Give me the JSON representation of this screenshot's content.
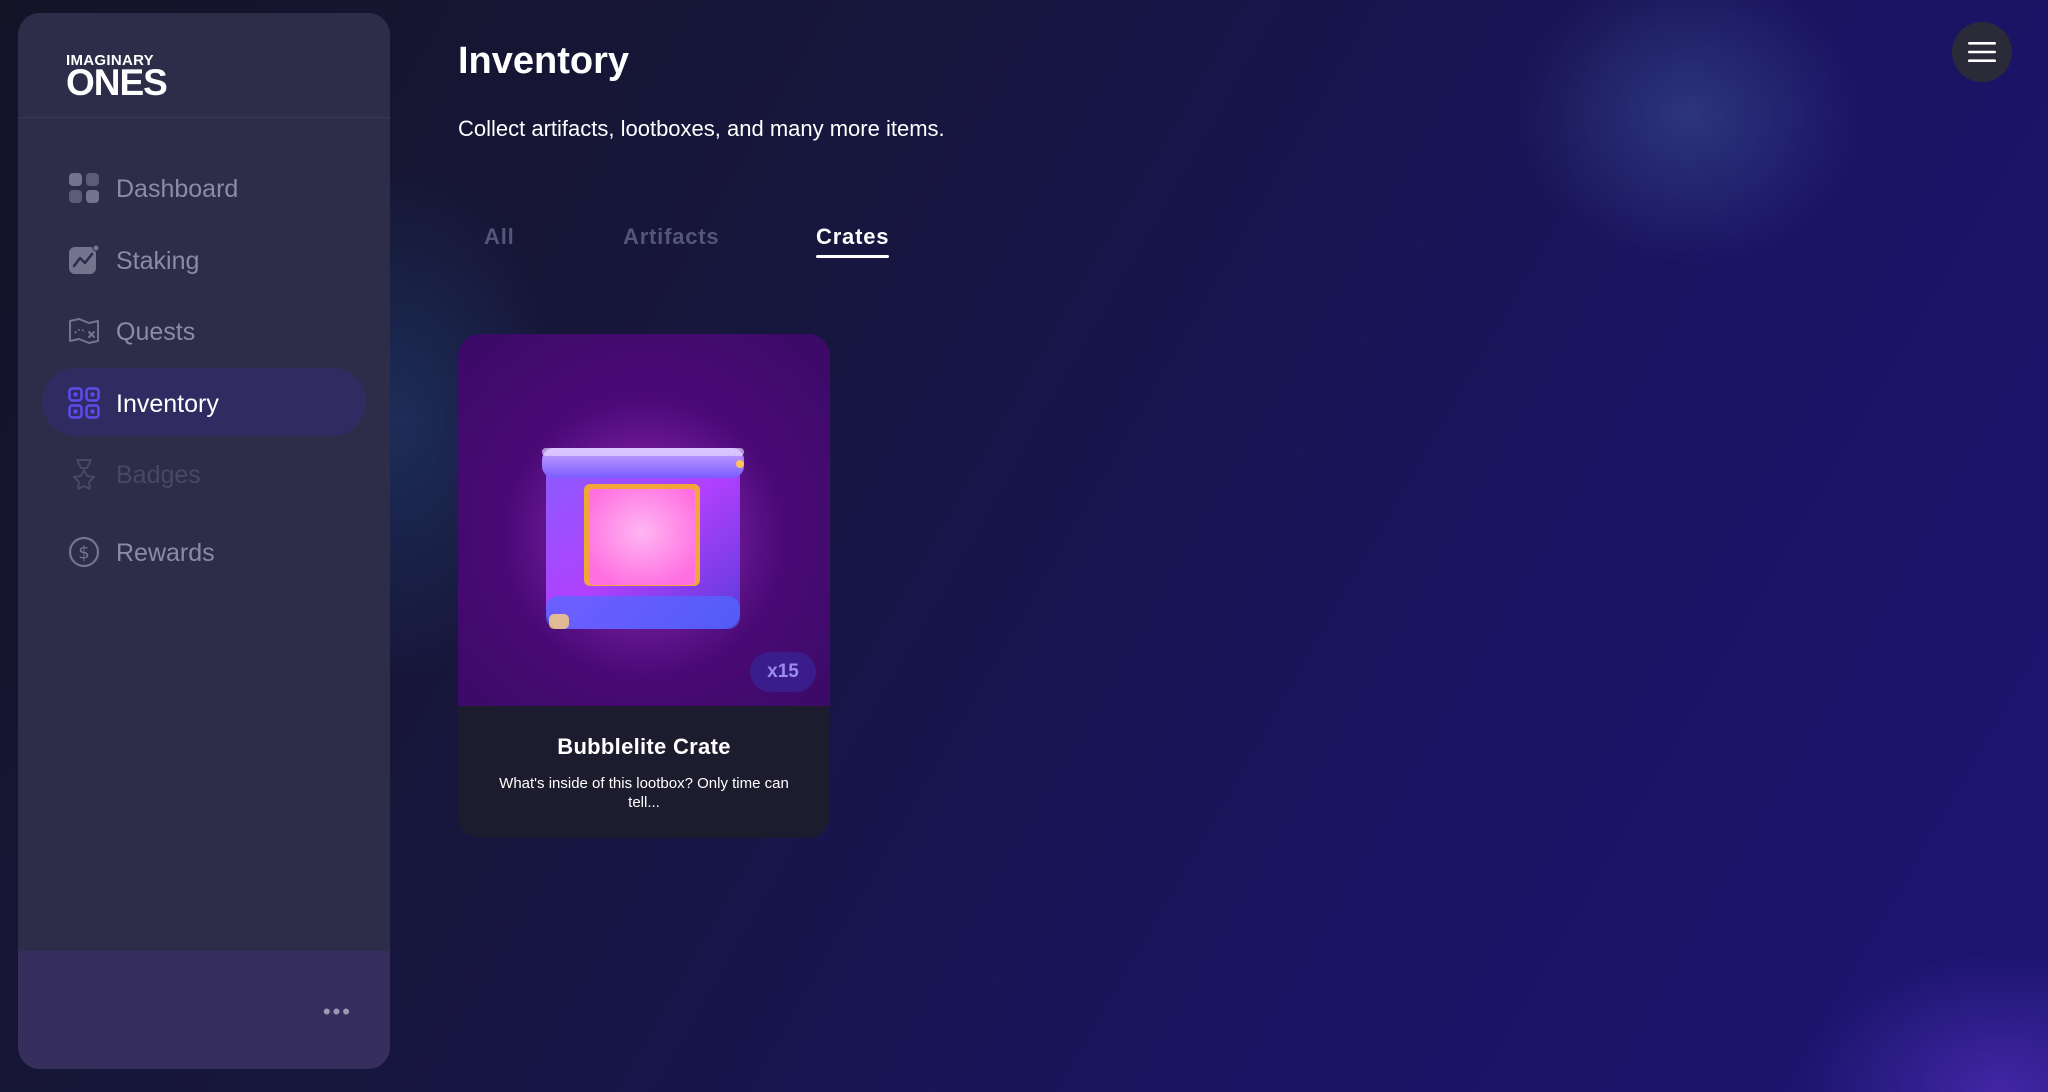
{
  "logo": {
    "line1": "IMAGINARY",
    "line2": "ONES"
  },
  "sidebar": {
    "items": [
      {
        "label": "Dashboard",
        "icon": "dashboard-icon",
        "state": "default"
      },
      {
        "label": "Staking",
        "icon": "staking-icon",
        "state": "default"
      },
      {
        "label": "Quests",
        "icon": "quests-icon",
        "state": "default"
      },
      {
        "label": "Inventory",
        "icon": "inventory-icon",
        "state": "active"
      },
      {
        "label": "Badges",
        "icon": "badges-icon",
        "state": "disabled"
      },
      {
        "label": "Rewards",
        "icon": "rewards-icon",
        "state": "default"
      }
    ],
    "footer_more": "•••"
  },
  "header": {
    "title": "Inventory",
    "subtitle": "Collect artifacts, lootboxes, and many more items."
  },
  "tabs": [
    {
      "label": "All",
      "active": false
    },
    {
      "label": "Artifacts",
      "active": false
    },
    {
      "label": "Crates",
      "active": true
    }
  ],
  "items": [
    {
      "name": "Bubblelite Crate",
      "description": "What's inside of this lootbox? Only time can tell...",
      "quantity": "x15"
    }
  ],
  "colors": {
    "accent": "#5b4bf0",
    "sidebar_bg": "#2d2d4a",
    "active_nav_bg": "#302c62",
    "card_bg": "#1c1c2e",
    "badge_bg": "#3a1d8a"
  }
}
